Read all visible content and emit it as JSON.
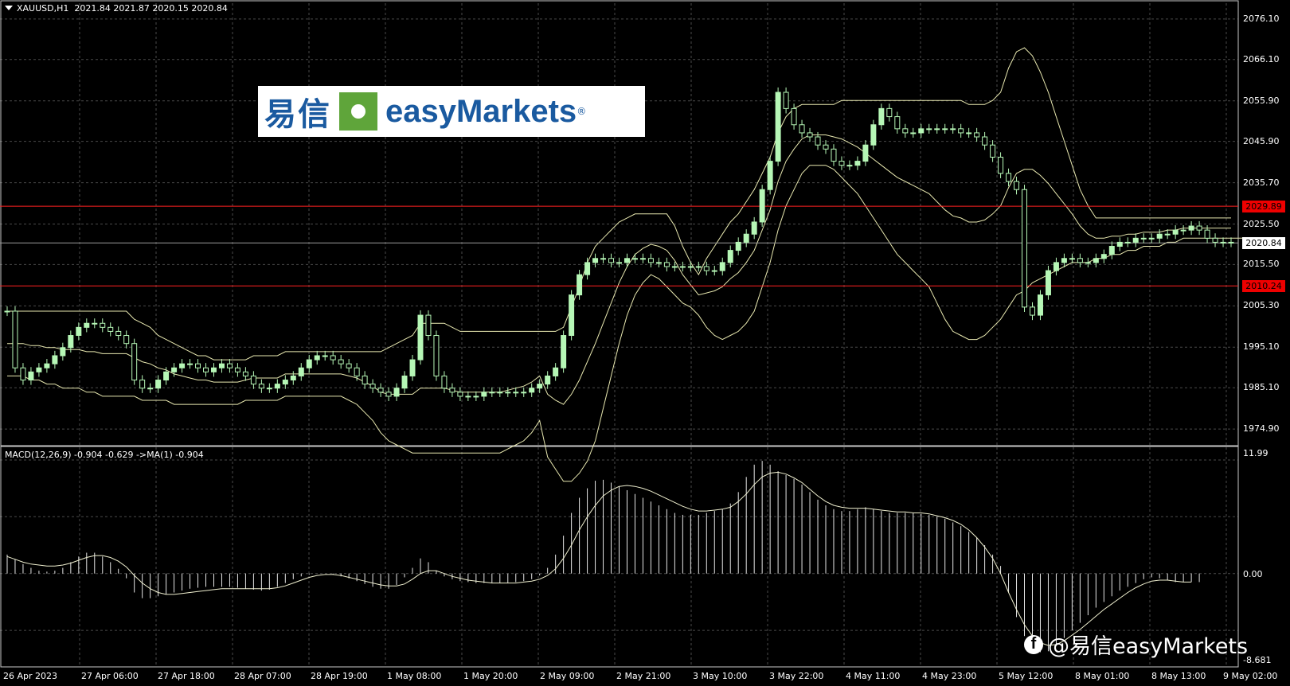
{
  "header": {
    "symbol": "XAUUSD,H1",
    "ohlc": "2021.84 2021.87 2020.15 2020.84"
  },
  "macd_header": "MACD(12,26,9) -0.904 -0.629  ->MA(1) -0.904",
  "logo": {
    "cn": "易信",
    "en": "easyMarkets"
  },
  "watermark": "@易信easyMarkets",
  "colors": {
    "bg": "#000000",
    "bull": "#b6f7b6",
    "grid": "#4a4a4a",
    "level": "#ff2020",
    "band": "#e8e8b0"
  },
  "price_axis": [
    "2076.10",
    "2066.10",
    "2055.90",
    "2045.90",
    "2035.70",
    "2025.50",
    "2015.50",
    "2005.30",
    "1995.10",
    "1985.10",
    "1974.90"
  ],
  "macd_axis": {
    "top": "11.99",
    "zero": "0.00",
    "bottom": "-8.681"
  },
  "levels": [
    {
      "label": "2029.89",
      "price": 2029.89,
      "kind": "red"
    },
    {
      "label": "2020.84",
      "price": 2020.84,
      "kind": "current"
    },
    {
      "label": "2010.24",
      "price": 2010.24,
      "kind": "red"
    }
  ],
  "time_axis": [
    "26 Apr 2023",
    "27 Apr 06:00",
    "27 Apr 18:00",
    "28 Apr 07:00",
    "28 Apr 19:00",
    "1 May 08:00",
    "1 May 20:00",
    "2 May 09:00",
    "2 May 21:00",
    "3 May 10:00",
    "3 May 22:00",
    "4 May 11:00",
    "4 May 23:00",
    "5 May 12:00",
    "8 May 01:00",
    "8 May 13:00",
    "9 May 02:00"
  ],
  "chart_data": {
    "type": "line",
    "title": "XAUUSD,H1",
    "price_range": [
      1971.0,
      2080.0
    ],
    "close": [
      2004,
      1990,
      1987,
      1989,
      1990,
      1991,
      1993,
      1995,
      1998,
      2000,
      2001,
      2001,
      2000,
      1999,
      1998,
      1996,
      1987,
      1985,
      1985,
      1987,
      1989,
      1990,
      1991,
      1991,
      1990,
      1989,
      1990,
      1991,
      1990,
      1989,
      1988,
      1986,
      1985,
      1985,
      1986,
      1987,
      1988,
      1990,
      1992,
      1993,
      1993,
      1992,
      1991,
      1990,
      1988,
      1986,
      1985,
      1984,
      1983,
      1985,
      1988,
      1992,
      2003,
      1998,
      1988,
      1985,
      1984,
      1983,
      1983,
      1983,
      1984,
      1984,
      1984,
      1984,
      1984,
      1984,
      1985,
      1986,
      1988,
      1990,
      1998,
      2008,
      2013,
      2016,
      2017,
      2017,
      2016,
      2016,
      2017,
      2017,
      2017,
      2016,
      2016,
      2015,
      2015,
      2015,
      2015,
      2015,
      2014,
      2014,
      2016,
      2019,
      2021,
      2023,
      2026,
      2034,
      2041,
      2058,
      2054,
      2050,
      2048,
      2047,
      2045,
      2044,
      2041,
      2040,
      2040,
      2041,
      2045,
      2050,
      2054,
      2052,
      2049,
      2048,
      2048,
      2049,
      2049,
      2049,
      2049,
      2049,
      2048,
      2048,
      2047,
      2045,
      2042,
      2038,
      2036,
      2034,
      2005,
      2003,
      2008,
      2014,
      2016,
      2017,
      2017,
      2016,
      2016,
      2017,
      2018,
      2020,
      2021,
      2021,
      2022,
      2022,
      2022,
      2023,
      2023,
      2024,
      2024,
      2025,
      2024,
      2022,
      2021,
      2021,
      2021
    ],
    "bollinger": {
      "upper": [
        2004,
        2004,
        2004,
        2004,
        2004,
        2004,
        2004,
        2004,
        2004,
        2004,
        2004,
        2004,
        2004,
        2004,
        2004,
        2004,
        2002,
        2001,
        2000,
        1998,
        1997,
        1996,
        1995,
        1994,
        1993,
        1993,
        1992,
        1992,
        1992,
        1992,
        1992,
        1993,
        1993,
        1993,
        1993,
        1994,
        1994,
        1994,
        1994,
        1994,
        1994,
        1994,
        1994,
        1994,
        1994,
        1994,
        1994,
        1994,
        1995,
        1996,
        1997,
        1998,
        2001,
        2001,
        2001,
        2001,
        2000,
        1999,
        1999,
        1999,
        1999,
        1999,
        1999,
        1999,
        1999,
        1999,
        1999,
        1999,
        1999,
        1999,
        2000,
        2005,
        2010,
        2016,
        2020,
        2022,
        2024,
        2026,
        2027,
        2028,
        2028,
        2028,
        2028,
        2028,
        2025,
        2020,
        2016,
        2013,
        2017,
        2020,
        2023,
        2026,
        2028,
        2031,
        2034,
        2038,
        2042,
        2048,
        2052,
        2054,
        2055,
        2055,
        2055,
        2055,
        2055,
        2056,
        2056,
        2056,
        2056,
        2056,
        2056,
        2056,
        2056,
        2056,
        2056,
        2056,
        2056,
        2056,
        2056,
        2056,
        2056,
        2055,
        2055,
        2055,
        2056,
        2058,
        2064,
        2068,
        2069,
        2067,
        2063,
        2058,
        2052,
        2046,
        2040,
        2034,
        2030,
        2027,
        2027,
        2027,
        2027,
        2027,
        2027,
        2027,
        2027,
        2027,
        2027,
        2027,
        2027,
        2027,
        2027,
        2027,
        2027,
        2027,
        2027
      ],
      "lower": [
        1988,
        1988,
        1988,
        1987,
        1987,
        1986,
        1986,
        1985,
        1985,
        1985,
        1984,
        1984,
        1983,
        1983,
        1983,
        1983,
        1983,
        1982,
        1982,
        1982,
        1982,
        1981,
        1981,
        1981,
        1981,
        1981,
        1981,
        1981,
        1981,
        1981,
        1982,
        1982,
        1982,
        1982,
        1982,
        1983,
        1983,
        1983,
        1983,
        1983,
        1983,
        1983,
        1983,
        1982,
        1981,
        1979,
        1977,
        1974,
        1972,
        1971,
        1970,
        1969,
        1969,
        1969,
        1969,
        1969,
        1969,
        1969,
        1969,
        1969,
        1969,
        1969,
        1969,
        1970,
        1971,
        1972,
        1974,
        1977,
        1968,
        1965,
        1962,
        1962,
        1964,
        1967,
        1972,
        1980,
        1988,
        1996,
        2003,
        2008,
        2011,
        2013,
        2012,
        2010,
        2008,
        2006,
        2005,
        2003,
        2000,
        1998,
        1997,
        1998,
        1999,
        2001,
        2004,
        2010,
        2016,
        2024,
        2030,
        2034,
        2038,
        2040,
        2040,
        2040,
        2039,
        2037,
        2035,
        2033,
        2030,
        2027,
        2024,
        2021,
        2018,
        2016,
        2014,
        2012,
        2010,
        2006,
        2002,
        1999,
        1998,
        1997,
        1997,
        1998,
        2000,
        2002,
        2005,
        2008,
        2009,
        2011,
        2012,
        2013,
        2014,
        2015,
        2016,
        2016,
        2016,
        2017,
        2017,
        2018,
        2018,
        2019,
        2019,
        2020,
        2020,
        2020,
        2021,
        2021,
        2022,
        2022,
        2022,
        2022,
        2022,
        2022,
        2022,
        2022,
        2022,
        2022,
        2022,
        2022,
        2022
      ]
    },
    "macd": {
      "range": [
        -8.681,
        11.99
      ],
      "hist": [
        2,
        1.5,
        1,
        0.6,
        0.3,
        0.2,
        0.3,
        0.6,
        1.2,
        1.8,
        2.2,
        2.2,
        1.8,
        1.2,
        0.5,
        -0.5,
        -2,
        -2.6,
        -2.6,
        -2.4,
        -2.2,
        -2,
        -1.8,
        -1.6,
        -1.5,
        -1.4,
        -1.4,
        -1.4,
        -1.4,
        -1.5,
        -1.6,
        -1.7,
        -1.8,
        -1.7,
        -1.4,
        -1,
        -0.6,
        -0.3,
        -0.1,
        0,
        0,
        -0.1,
        -0.3,
        -0.5,
        -0.8,
        -1.1,
        -1.4,
        -1.6,
        -1.6,
        -1.2,
        -0.4,
        0.6,
        1.6,
        1.2,
        0.3,
        -0.3,
        -0.6,
        -0.8,
        -0.9,
        -1,
        -1,
        -1,
        -1,
        -1,
        -0.9,
        -0.8,
        -0.6,
        -0.2,
        0.6,
        2,
        4,
        6.4,
        8,
        9,
        9.8,
        9.9,
        9.6,
        9.2,
        8.8,
        8.4,
        8,
        7.6,
        7.2,
        6.8,
        6.4,
        6.2,
        6.2,
        6.2,
        6.4,
        6.6,
        6.8,
        7.4,
        8.6,
        10.2,
        11.5,
        11.9,
        11.5,
        10.8,
        10.4,
        10,
        9.4,
        8.6,
        7.8,
        7.2,
        6.8,
        6.6,
        6.6,
        6.8,
        7,
        6.8,
        6.6,
        6.4,
        6.4,
        6.4,
        6.4,
        6.3,
        6.2,
        6,
        5.8,
        5.4,
        5,
        4.4,
        3.8,
        3,
        2,
        0.8,
        -2,
        -4.6,
        -6.6,
        -8,
        -8.3,
        -8.2,
        -7.6,
        -6.8,
        -6,
        -5.2,
        -4.4,
        -3.6,
        -3,
        -2.4,
        -1.8,
        -1.4,
        -1,
        -0.6,
        -0.4,
        -0.5,
        -0.7,
        -0.9,
        -0.9,
        -0.9,
        -0.9
      ],
      "signal": [
        1.8,
        1.5,
        1.2,
        1,
        0.9,
        0.8,
        0.8,
        0.9,
        1.1,
        1.4,
        1.7,
        1.9,
        1.9,
        1.7,
        1.3,
        0.7,
        -0.2,
        -1,
        -1.6,
        -2,
        -2.2,
        -2.2,
        -2.1,
        -2,
        -1.9,
        -1.8,
        -1.7,
        -1.6,
        -1.6,
        -1.6,
        -1.6,
        -1.6,
        -1.6,
        -1.6,
        -1.5,
        -1.3,
        -1,
        -0.7,
        -0.4,
        -0.2,
        -0.1,
        -0.1,
        -0.2,
        -0.4,
        -0.6,
        -0.8,
        -1,
        -1.2,
        -1.3,
        -1.3,
        -1.1,
        -0.6,
        0,
        0.3,
        0.3,
        0,
        -0.3,
        -0.5,
        -0.7,
        -0.8,
        -0.9,
        -1,
        -1,
        -1,
        -1,
        -0.9,
        -0.8,
        -0.6,
        -0.2,
        0.5,
        1.6,
        3,
        4.6,
        6,
        7.2,
        8.2,
        8.8,
        9.2,
        9.3,
        9.2,
        9,
        8.7,
        8.3,
        7.9,
        7.5,
        7.1,
        6.8,
        6.6,
        6.6,
        6.7,
        6.8,
        7,
        7.6,
        8.4,
        9.4,
        10.2,
        10.6,
        10.7,
        10.5,
        10.1,
        9.6,
        8.9,
        8.2,
        7.6,
        7.2,
        7,
        6.9,
        6.9,
        6.9,
        6.8,
        6.7,
        6.6,
        6.5,
        6.5,
        6.4,
        6.4,
        6.3,
        6.1,
        5.9,
        5.6,
        5.2,
        4.6,
        3.8,
        2.8,
        1.6,
        0,
        -2,
        -3.8,
        -5.4,
        -6.6,
        -7.3,
        -7.6,
        -7.5,
        -7.1,
        -6.5,
        -5.9,
        -5.2,
        -4.5,
        -3.8,
        -3.2,
        -2.6,
        -2,
        -1.5,
        -1.1,
        -0.8,
        -0.7,
        -0.7,
        -0.8,
        -0.9,
        -0.9
      ]
    }
  }
}
